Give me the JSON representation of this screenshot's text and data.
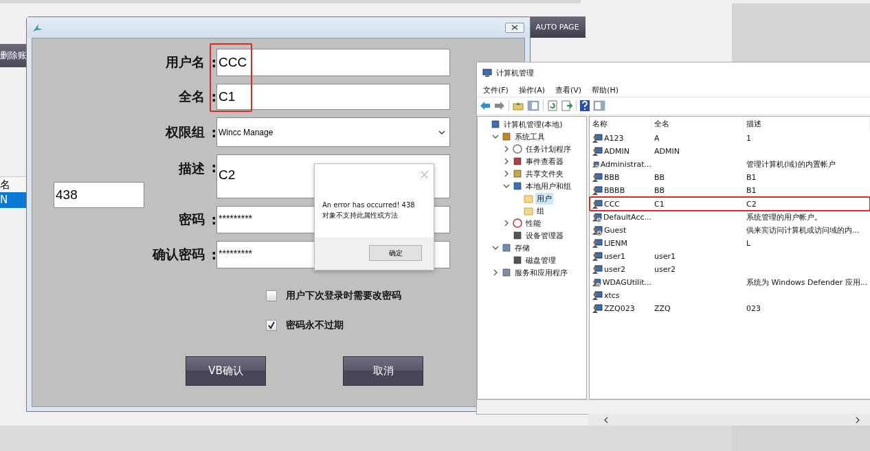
{
  "background": {
    "delete_button": "删除账",
    "list_header": "名",
    "list_selected_row": {
      "text": "N",
      "selected": true
    },
    "auto_page_button": "AUTO PAGE"
  },
  "user_dialog": {
    "fields": [
      {
        "label": "用户名",
        "colon": ":",
        "kind": "text",
        "value": "CCC"
      },
      {
        "label": "全名",
        "colon": ":",
        "kind": "text",
        "value": "C1"
      },
      {
        "label": "权限组",
        "colon": ":",
        "kind": "dropdown",
        "value": "Wincc Manage"
      },
      {
        "label": "描述",
        "colon": ":",
        "kind": "multiline",
        "value": "C2"
      },
      {
        "label": "密码",
        "colon": ":",
        "kind": "password",
        "value": "*********"
      },
      {
        "label": "确认密码",
        "colon": ":",
        "kind": "password",
        "value": "*********"
      }
    ],
    "error_code_field": "438",
    "checkboxes": [
      {
        "label": "用户下次登录时需要改密码",
        "checked": false
      },
      {
        "label": "密码永不过期",
        "checked": true
      }
    ],
    "buttons": [
      "VB确认",
      "取消"
    ]
  },
  "error_popup": {
    "message": "An error has occurred!  438",
    "detail": "对象不支持此属性或方法",
    "ok_button": "确定"
  },
  "computer_management": {
    "title": "计算机管理",
    "menu": [
      "文件(F)",
      "操作(A)",
      "查看(V)",
      "帮助(H)"
    ],
    "tree": [
      {
        "label": "计算机管理(本地)",
        "kind": "computer",
        "selected": false,
        "children": [
          {
            "label": "系统工具",
            "kind": "tools",
            "expanded": true,
            "selected": false,
            "children": [
              {
                "label": "任务计划程序",
                "kind": "clock",
                "expanded": false,
                "selected": false
              },
              {
                "label": "事件查看器",
                "kind": "event",
                "expanded": false,
                "selected": false
              },
              {
                "label": "共享文件夹",
                "kind": "share",
                "expanded": false,
                "selected": false
              },
              {
                "label": "本地用户和组",
                "kind": "users",
                "expanded": true,
                "selected": false,
                "children": [
                  {
                    "label": "用户",
                    "kind": "folder",
                    "selected": true
                  },
                  {
                    "label": "组",
                    "kind": "folder",
                    "selected": false
                  }
                ]
              },
              {
                "label": "性能",
                "kind": "performance",
                "expanded": false,
                "selected": false
              },
              {
                "label": "设备管理器",
                "kind": "device",
                "selected": false
              }
            ]
          },
          {
            "label": "存储",
            "kind": "storage",
            "expanded": true,
            "selected": false,
            "children": [
              {
                "label": "磁盘管理",
                "kind": "disk",
                "selected": false
              }
            ]
          },
          {
            "label": "服务和应用程序",
            "kind": "services",
            "expanded": false,
            "selected": false
          }
        ]
      }
    ],
    "columns": [
      "名称",
      "全名",
      "描述"
    ],
    "rows": [
      {
        "name": "A123",
        "full_name": "A",
        "description": "1",
        "disabled": false,
        "highlighted": false
      },
      {
        "name": "ADMIN",
        "full_name": "ADMIN",
        "disabled": false,
        "highlighted": false
      },
      {
        "name": "Administrat...",
        "description": "管理计算机(域)的内置帐户",
        "disabled": true,
        "highlighted": false
      },
      {
        "name": "BBB",
        "full_name": "BB",
        "description": "B1",
        "disabled": false,
        "highlighted": false
      },
      {
        "name": "BBBB",
        "full_name": "BB",
        "description": "B1",
        "disabled": false,
        "highlighted": false
      },
      {
        "name": "CCC",
        "full_name": "C1",
        "description": "C2",
        "disabled": false,
        "highlighted": true
      },
      {
        "name": "DefaultAcc...",
        "description": "系统管理的用户帐户。",
        "disabled": true,
        "highlighted": false
      },
      {
        "name": "Guest",
        "description": "供来宾访问计算机或访问域的内...",
        "disabled": true,
        "highlighted": false
      },
      {
        "name": "LIENM",
        "description": "L",
        "disabled": false,
        "highlighted": false
      },
      {
        "name": "user1",
        "full_name": "user1",
        "disabled": false,
        "highlighted": false
      },
      {
        "name": "user2",
        "full_name": "user2",
        "disabled": false,
        "highlighted": false
      },
      {
        "name": "WDAGUtilit...",
        "description": "系统为 Windows Defender 应用...",
        "disabled": true,
        "highlighted": false
      },
      {
        "name": "xtcs",
        "disabled": false,
        "highlighted": false
      },
      {
        "name": "ZZQ023",
        "full_name": "ZZQ",
        "description": "023",
        "disabled": false,
        "highlighted": false
      }
    ]
  },
  "annotation": {
    "highlight_fields": true
  }
}
